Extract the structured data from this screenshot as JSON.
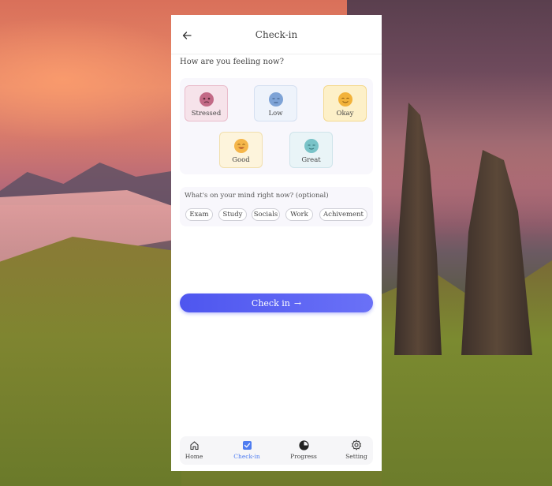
{
  "header": {
    "title": "Check-in"
  },
  "question": "How are you feeling now?",
  "moods": [
    {
      "label": "Stressed",
      "face": "stressed-face-icon",
      "color": "#c26a86"
    },
    {
      "label": "Low",
      "face": "low-face-icon",
      "color": "#7ea3d6"
    },
    {
      "label": "Okay",
      "face": "okay-face-icon",
      "color": "#f2b23a"
    },
    {
      "label": "Good",
      "face": "good-face-icon",
      "color": "#f5b64a"
    },
    {
      "label": "Great",
      "face": "great-face-icon",
      "color": "#79c3c8"
    }
  ],
  "mind": {
    "title": "What's on your mind right now? (optional)",
    "chips": [
      "Exam",
      "Study",
      "Socials",
      "Work",
      "Achivement"
    ]
  },
  "checkin_button": {
    "label": "Check in",
    "arrow": "→",
    "color": "#5a62f2"
  },
  "tabs": [
    {
      "label": "Home",
      "icon": "home-icon"
    },
    {
      "label": "Check-in",
      "icon": "checkbox-icon",
      "active": true
    },
    {
      "label": "Progress",
      "icon": "progress-icon"
    },
    {
      "label": "Setting",
      "icon": "gear-icon"
    }
  ],
  "colors": {
    "accent": "#4e7cf0",
    "button": "#5a62f2"
  }
}
